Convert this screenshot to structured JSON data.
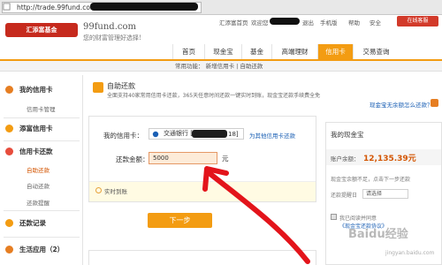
{
  "browser": {
    "address_value": "http://trade.99fund.com/"
  },
  "header": {
    "logo_text": "汇添富基金",
    "domain": "99fund.com",
    "slogan": "您的财富管理好选择!",
    "toplinks": {
      "home": "汇添富首页",
      "welcome": "欢迎您",
      "logout": "退出",
      "mobile": "手机版",
      "help": "帮助",
      "safe": "安全",
      "follow": "在线客服"
    }
  },
  "nav": {
    "tabs": [
      "首页",
      "现金宝",
      "基金",
      "高端理财",
      "信用卡",
      "交易查询"
    ],
    "active_index": 4
  },
  "subnav": {
    "text": "常用功能：  新增信用卡  |  自助还款"
  },
  "sidebar": {
    "sections": [
      {
        "title": "我的信用卡",
        "items": [
          "信用卡管理"
        ]
      },
      {
        "title": "添富信用卡",
        "items": []
      },
      {
        "title": "信用卡还款",
        "items": [
          "自助还款",
          "自动还款",
          "还款提醒"
        ],
        "active_item": 0
      },
      {
        "title": "还款记录",
        "items": []
      },
      {
        "title": "生活应用（2）",
        "items": []
      }
    ]
  },
  "main": {
    "title": "自助还款",
    "subtitle": "全面支持40家常用信用卡还款，365天任意时间还款一键实时到账，现金宝还款手续费全免",
    "promo_link": "现金宝无余额怎么还款？",
    "form": {
      "card_label": "我的信用卡：",
      "card_value": "交通银行 [尾号",
      "card_suffix": "18]",
      "add_card": "为其他信用卡还款",
      "amount_label": "还款金额：",
      "amount_value": "5000",
      "unit": "元",
      "arrival": "实时到账",
      "next_button": "下一步"
    }
  },
  "right_panel": {
    "title": "我的现金宝",
    "balance_label": "账户余额：",
    "balance_value": "12,135.39元",
    "note": "现金宝余额不足，点击下一步还款",
    "reminder_label": "还款提醒日",
    "reminder_value": "请选择",
    "auto_label": "我已阅读并同意",
    "auto_link": "《现金宝还款协议》"
  },
  "watermark": {
    "text": "Baidu经验",
    "url": "jingyan.baidu.com"
  },
  "colors": {
    "brand_orange": "#f39c12",
    "brand_red": "#c62a1d",
    "link_blue": "#1a5fb4",
    "balance_orange": "#d35400"
  }
}
